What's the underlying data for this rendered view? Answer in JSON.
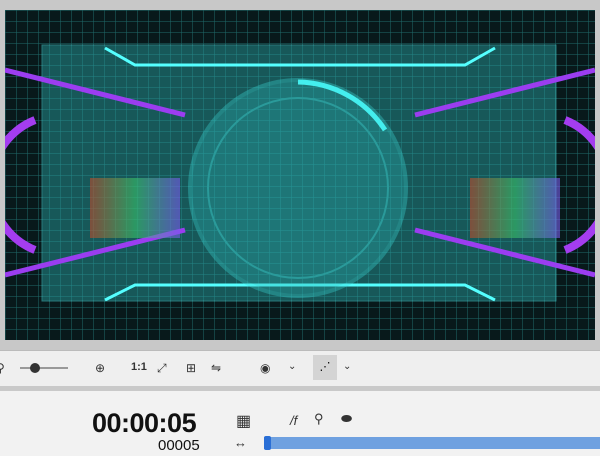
{
  "toolbar": {
    "zoom_ratio_label": "1:1",
    "icons": [
      "zoom-out-icon",
      "zoom-slider",
      "zoom-in-icon",
      "fit-icon",
      "safe-area-icon",
      "flip-icon",
      "overlay-icon",
      "motion-path-icon"
    ]
  },
  "timeline": {
    "timecode": "00:00:05",
    "frame_number": "00005",
    "expression_label": "/f"
  },
  "colors": {
    "accent": "#6fa1e0",
    "playhead": "#2a6fd6",
    "grid": "#1f6b6b",
    "hud": "#3ad6d6",
    "purple": "#9b3df0"
  }
}
